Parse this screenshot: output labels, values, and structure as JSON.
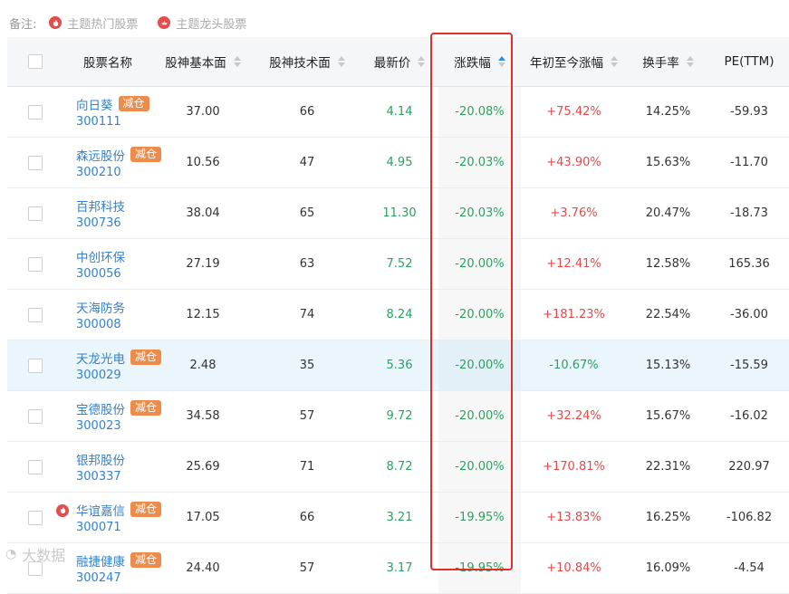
{
  "legend": {
    "label": "备注:",
    "items": [
      {
        "icon": "flame-hot-icon",
        "text": "主题热门股票"
      },
      {
        "icon": "flame-leader-icon",
        "text": "主题龙头股票"
      }
    ]
  },
  "columns": [
    "股票名称",
    "股神基本面",
    "股神技术面",
    "最新价",
    "涨跌幅",
    "年初至今涨幅",
    "换手率",
    "PE(TTM)"
  ],
  "rows": [
    {
      "name": "向日葵",
      "code": "300111",
      "badge": "减仓",
      "hot": false,
      "fund": "37.00",
      "tech": "66",
      "price": "4.14",
      "chg": "-20.08%",
      "ytd": "+75.42%",
      "turnover": "14.25%",
      "pe": "-59.93"
    },
    {
      "name": "森远股份",
      "code": "300210",
      "badge": "减仓",
      "hot": false,
      "fund": "10.56",
      "tech": "47",
      "price": "4.95",
      "chg": "-20.03%",
      "ytd": "+43.90%",
      "turnover": "15.63%",
      "pe": "-11.70"
    },
    {
      "name": "百邦科技",
      "code": "300736",
      "badge": "",
      "hot": false,
      "fund": "38.04",
      "tech": "65",
      "price": "11.30",
      "chg": "-20.03%",
      "ytd": "+3.76%",
      "turnover": "20.47%",
      "pe": "-18.73"
    },
    {
      "name": "中创环保",
      "code": "300056",
      "badge": "",
      "hot": false,
      "fund": "27.19",
      "tech": "63",
      "price": "7.52",
      "chg": "-20.00%",
      "ytd": "+12.41%",
      "turnover": "12.58%",
      "pe": "165.36"
    },
    {
      "name": "天海防务",
      "code": "300008",
      "badge": "",
      "hot": false,
      "fund": "12.15",
      "tech": "74",
      "price": "8.24",
      "chg": "-20.00%",
      "ytd": "+181.23%",
      "turnover": "22.54%",
      "pe": "-36.00"
    },
    {
      "name": "天龙光电",
      "code": "300029",
      "badge": "减仓",
      "hot": false,
      "fund": "2.48",
      "tech": "35",
      "price": "5.36",
      "chg": "-20.00%",
      "ytd": "-10.67%",
      "turnover": "15.13%",
      "pe": "-15.59"
    },
    {
      "name": "宝德股份",
      "code": "300023",
      "badge": "减仓",
      "hot": false,
      "fund": "34.58",
      "tech": "57",
      "price": "9.72",
      "chg": "-20.00%",
      "ytd": "+32.24%",
      "turnover": "15.67%",
      "pe": "-16.02"
    },
    {
      "name": "银邦股份",
      "code": "300337",
      "badge": "",
      "hot": false,
      "fund": "25.69",
      "tech": "71",
      "price": "8.72",
      "chg": "-20.00%",
      "ytd": "+170.81%",
      "turnover": "22.31%",
      "pe": "220.97"
    },
    {
      "name": "华谊嘉信",
      "code": "300071",
      "badge": "减仓",
      "hot": true,
      "fund": "17.05",
      "tech": "66",
      "price": "3.21",
      "chg": "-19.95%",
      "ytd": "+13.83%",
      "turnover": "16.25%",
      "pe": "-106.82"
    },
    {
      "name": "融捷健康",
      "code": "300247",
      "badge": "减仓",
      "hot": false,
      "fund": "24.40",
      "tech": "57",
      "price": "3.17",
      "chg": "-19.95%",
      "ytd": "+10.84%",
      "turnover": "16.09%",
      "pe": "-4.54"
    }
  ],
  "highlight_row": 5,
  "sorted_column": "涨跌幅",
  "colors": {
    "up": "#e24a4a",
    "down": "#2aa160",
    "link": "#3582c9",
    "badge": "#ed8c4a",
    "highlight_box": "#e22d2d"
  },
  "watermark": "大数据"
}
